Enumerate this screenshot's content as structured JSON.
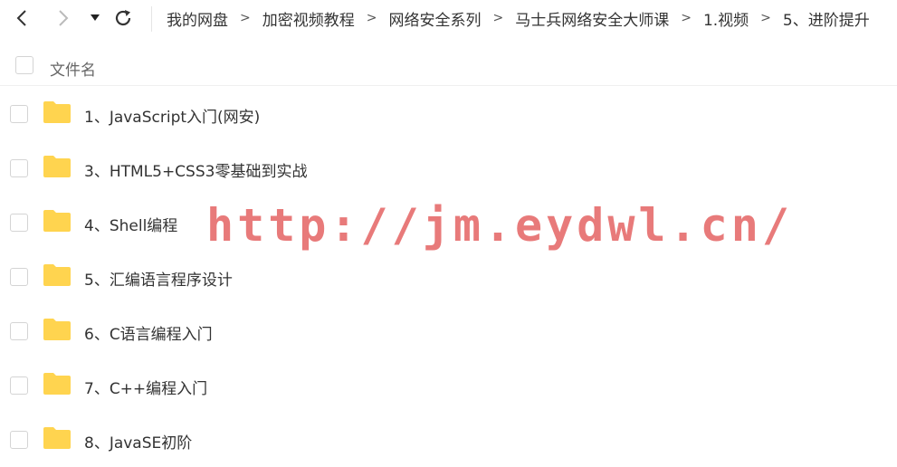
{
  "nav": {
    "back_icon": "chevron-left-icon",
    "forward_icon": "chevron-right-icon",
    "dropdown_icon": "caret-down-icon",
    "refresh_icon": "refresh-icon"
  },
  "breadcrumb": [
    "我的网盘",
    "加密视频教程",
    "网络安全系列",
    "马士兵网络安全大师课",
    "1.视频",
    "5、进阶提升"
  ],
  "breadcrumb_separator": ">",
  "list_header": {
    "column_label": "文件名"
  },
  "files": [
    {
      "name": "1、JavaScript入门(网安)",
      "type": "folder"
    },
    {
      "name": "3、HTML5+CSS3零基础到实战",
      "type": "folder"
    },
    {
      "name": "4、Shell编程",
      "type": "folder"
    },
    {
      "name": "5、汇编语言程序设计",
      "type": "folder"
    },
    {
      "name": "6、C语言编程入门",
      "type": "folder"
    },
    {
      "name": "7、C++编程入门",
      "type": "folder"
    },
    {
      "name": "8、JavaSE初阶",
      "type": "folder"
    }
  ],
  "watermark": "http://jm.eydwl.cn/",
  "colors": {
    "folder": "#FFD44F",
    "watermark": "#E87A7A"
  }
}
